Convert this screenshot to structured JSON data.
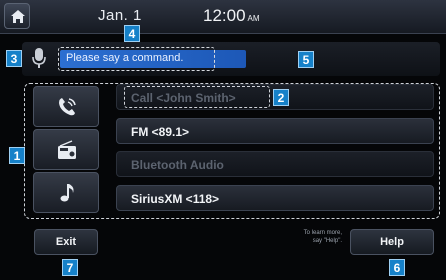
{
  "status_bar": {
    "date": "Jan. 1",
    "time": "12:00",
    "ampm": "AM"
  },
  "voice_command": {
    "prompt": "Please say a command."
  },
  "categories": [
    {
      "icon": "phone-icon"
    },
    {
      "icon": "radio-icon"
    },
    {
      "icon": "music-note-icon"
    }
  ],
  "list": [
    {
      "label": "Call <John Smith>",
      "enabled": false
    },
    {
      "label": "FM <89.1>",
      "enabled": true
    },
    {
      "label": "Bluetooth Audio",
      "enabled": false
    },
    {
      "label": "SiriusXM <118>",
      "enabled": true
    }
  ],
  "footer": {
    "exit_label": "Exit",
    "help_hint_line1": "To learn more,",
    "help_hint_line2": "say \"Help\".",
    "help_label": "Help"
  },
  "callouts": [
    "1",
    "2",
    "3",
    "4",
    "5",
    "6",
    "7"
  ],
  "colors": {
    "accent": "#1681c9",
    "command_field": "#2c6fd1",
    "background": "#050608"
  }
}
